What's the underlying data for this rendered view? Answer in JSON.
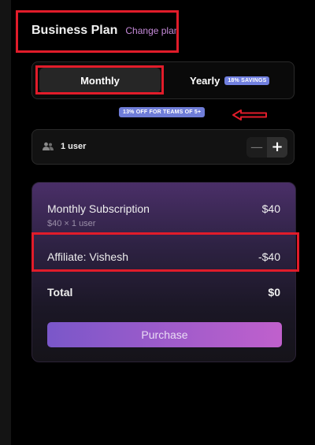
{
  "header": {
    "title": "Business Plan",
    "change_plan_label": "Change plan"
  },
  "billing": {
    "monthly_label": "Monthly",
    "yearly_label": "Yearly",
    "yearly_savings_badge": "18% SAVINGS",
    "selected": "Monthly"
  },
  "team_discount_badge": "13% OFF FOR TEAMS OF 5+",
  "users": {
    "label": "1 user",
    "icon": "users-icon",
    "decrement_symbol": "—",
    "increment_symbol": "+"
  },
  "summary": {
    "subscription_label": "Monthly Subscription",
    "subscription_amount": "$40",
    "subscription_detail": "$40 × 1 user",
    "affiliate_label": "Affiliate: Vishesh",
    "affiliate_amount": "-$40",
    "total_label": "Total",
    "total_amount": "$0",
    "purchase_label": "Purchase"
  },
  "colors": {
    "highlight": "#e11c2a",
    "accent_purple": "#c58ad8",
    "badge_blue": "#6f7dd8",
    "purchase_gradient_start": "#7a57c9",
    "purchase_gradient_end": "#c060cc"
  }
}
